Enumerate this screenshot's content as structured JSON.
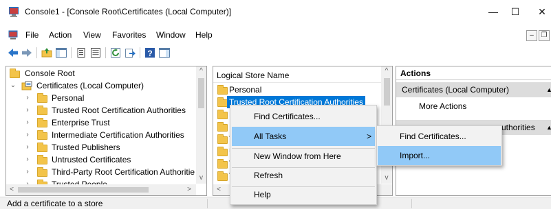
{
  "window": {
    "title": "Console1 - [Console Root\\Certificates (Local Computer)]",
    "controls": {
      "minimize": "—",
      "maximize": "☐",
      "close": "✕"
    }
  },
  "menubar": {
    "items": [
      "File",
      "Action",
      "View",
      "Favorites",
      "Window",
      "Help"
    ],
    "mdi_minimize": "–",
    "mdi_restore": "❐"
  },
  "toolbar": {
    "buttons": [
      "back-arrow-icon",
      "forward-arrow-icon",
      "up-folder-icon",
      "show-hide-tree-icon",
      "properties-icon",
      "export-list-icon",
      "refresh-icon",
      "export-icon",
      "help-icon",
      "show-hide-action-pane-icon"
    ]
  },
  "tree": {
    "root_label": "Console Root",
    "snapin_label": "Certificates (Local Computer)",
    "stores": [
      "Personal",
      "Trusted Root Certification Authorities",
      "Enterprise Trust",
      "Intermediate Certification Authorities",
      "Trusted Publishers",
      "Untrusted Certificates",
      "Third-Party Root Certification Authoritie",
      "Trusted People"
    ]
  },
  "list": {
    "column_header": "Logical Store Name",
    "rows": [
      "Personal",
      "Trusted Root Certification Authorities",
      "E",
      "I",
      "T",
      "U",
      "T",
      "T"
    ],
    "selected_index": 1
  },
  "actions": {
    "header": "Actions",
    "section1": "Certificates (Local Computer)",
    "section1_item": "More Actions",
    "section2": "Trusted Root Certification Authorities",
    "section2_visible_tail": "uthorities",
    "section2_hidden_prefix": "Trusted Root Certification A"
  },
  "context_menu": {
    "items": [
      "Find Certificates...",
      "All Tasks",
      "New Window from Here",
      "Refresh",
      "Help"
    ],
    "submenu_arrow": ">",
    "highlighted": "All Tasks"
  },
  "submenu": {
    "items": [
      "Find Certificates...",
      "Import..."
    ],
    "highlighted": "Import..."
  },
  "statusbar": {
    "text": "Add a certificate to a store"
  },
  "scroll_arrows": {
    "up": "^",
    "down": "v",
    "left": "<",
    "right": ">"
  },
  "colors": {
    "selection": "#0078d7",
    "menu_highlight": "#91c9f7",
    "actions_section_bg": "#dcdcdc",
    "folder": "#f3c44a"
  }
}
